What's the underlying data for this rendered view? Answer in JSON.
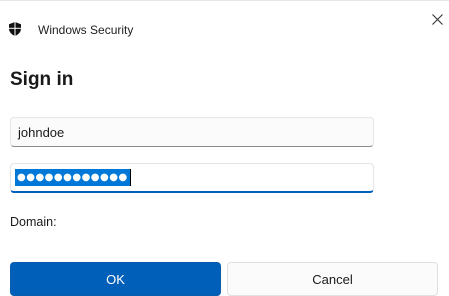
{
  "window": {
    "title": "Windows Security",
    "app_icon": "shield-icon",
    "close_icon": "close-icon"
  },
  "dialog": {
    "heading": "Sign in",
    "username_value": "johndoe",
    "password_mask": "●●●●●●●●●●●●",
    "domain_label": "Domain:"
  },
  "buttons": {
    "ok_label": "OK",
    "cancel_label": "Cancel"
  },
  "colors": {
    "accent": "#005fb8",
    "selection": "#0078d7"
  }
}
